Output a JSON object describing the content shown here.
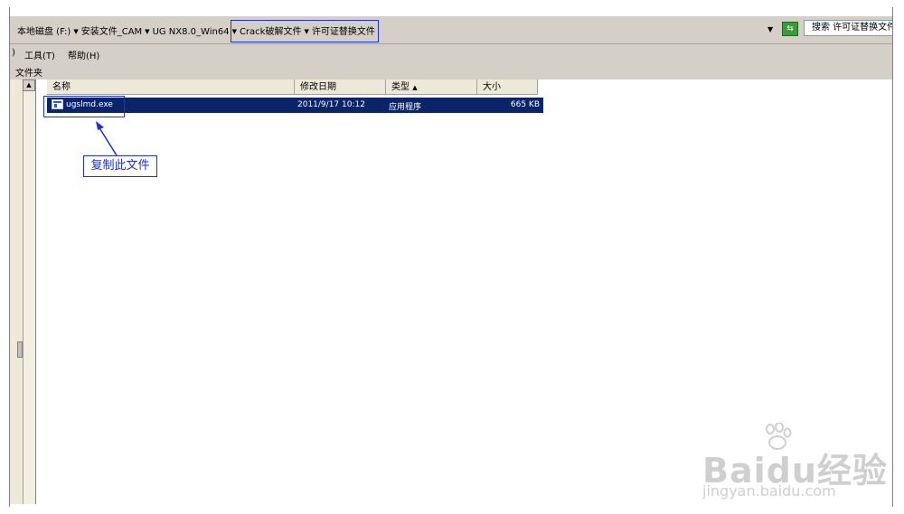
{
  "address": {
    "crumbs": [
      "本地磁盘 (F:)",
      "安装文件_CAM",
      "UG NX8.0_Win64",
      "Crack破解文件",
      "许可证替换文件"
    ],
    "dropdown_icon": "chevron-down-icon",
    "refresh_icon": "go-arrow-icon",
    "search_value": "搜索 许可证替换文件"
  },
  "menu": {
    "items": [
      ")",
      "工具(T)",
      "帮助(H)"
    ]
  },
  "pane": {
    "label": "文件夹"
  },
  "columns": {
    "name": "名称",
    "modified": "修改日期",
    "type": "类型",
    "size": "大小"
  },
  "files": [
    {
      "name": "ugslmd.exe",
      "modified": "2011/9/17 10:12",
      "type": "应用程序",
      "size": "665 KB",
      "icon": "exe-file-icon",
      "selected": true
    }
  ],
  "annotation": {
    "text": "复制此文件"
  },
  "watermark": {
    "brand": "Baidu经验",
    "url": "jingyan.baidu.com"
  },
  "colors": {
    "highlight": "#1f2fd1",
    "selection": "#0a246a",
    "chrome": "#d4d0c8"
  }
}
